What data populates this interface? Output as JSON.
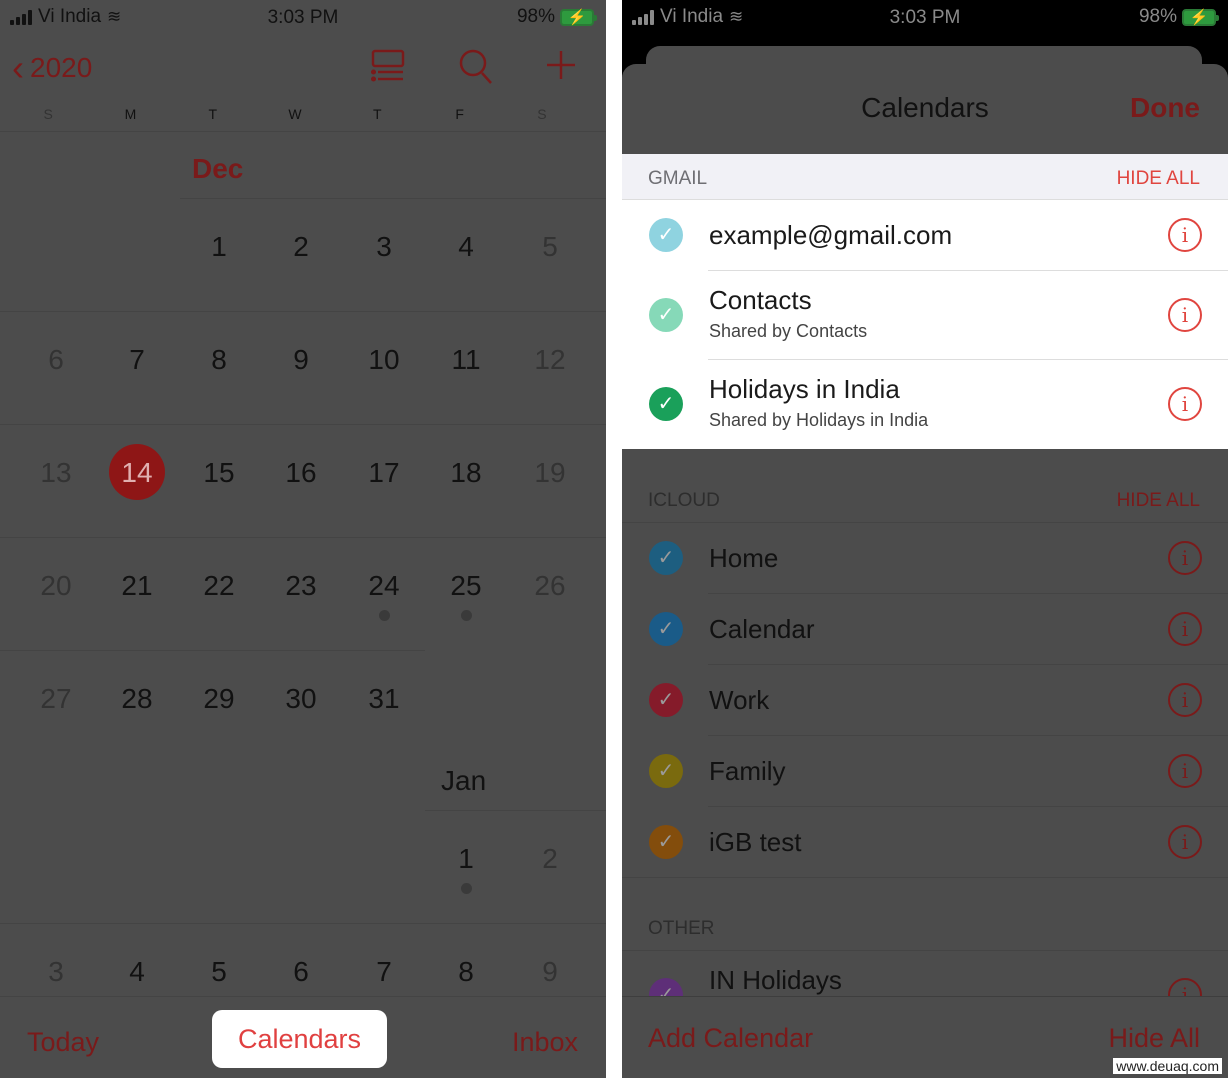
{
  "status_bar": {
    "carrier": "Vi India",
    "time": "3:03 PM",
    "battery": "98%"
  },
  "left": {
    "nav": {
      "back_label": "2020",
      "icons": [
        "list-view-icon",
        "search-icon",
        "add-icon"
      ]
    },
    "weekdays": [
      "S",
      "M",
      "T",
      "W",
      "T",
      "F",
      "S"
    ],
    "months": {
      "dec": "Dec",
      "jan": "Jan"
    },
    "weeks": [
      [
        "",
        "",
        "1",
        "2",
        "3",
        "4",
        "5"
      ],
      [
        "6",
        "7",
        "8",
        "9",
        "10",
        "11",
        "12"
      ],
      [
        "13",
        "14",
        "15",
        "16",
        "17",
        "18",
        "19"
      ],
      [
        "20",
        "21",
        "22",
        "23",
        "24",
        "25",
        "26"
      ],
      [
        "27",
        "28",
        "29",
        "30",
        "31",
        "",
        ""
      ],
      [
        "",
        "",
        "",
        "",
        "",
        "1",
        "2"
      ],
      [
        "3",
        "4",
        "5",
        "6",
        "7",
        "8",
        "9"
      ]
    ],
    "today": "14",
    "event_dots": [
      "Dec 24",
      "Dec 25",
      "Jan 1"
    ],
    "toolbar": {
      "today": "Today",
      "calendars": "Calendars",
      "inbox": "Inbox"
    }
  },
  "right": {
    "title": "Calendars",
    "done": "Done",
    "sections": {
      "gmail": {
        "label": "GMAIL",
        "hide_all": "HIDE ALL",
        "items": [
          {
            "name": "example@gmail.com",
            "sub": "",
            "color": "#8fd3e0",
            "checked": true
          },
          {
            "name": "Contacts",
            "sub": "Shared by Contacts",
            "color": "#86d9b8",
            "checked": true
          },
          {
            "name": "Holidays in India",
            "sub": "Shared by Holidays in India",
            "color": "#1aa05a",
            "checked": true
          }
        ]
      },
      "icloud": {
        "label": "ICLOUD",
        "hide_all": "HIDE ALL",
        "items": [
          {
            "name": "Home",
            "color": "#1d5e80",
            "checked": true
          },
          {
            "name": "Calendar",
            "color": "#1a5b88",
            "checked": true
          },
          {
            "name": "Work",
            "color": "#851b2a",
            "checked": true
          },
          {
            "name": "Family",
            "color": "#7a6a0e",
            "checked": true
          },
          {
            "name": "iGB test",
            "color": "#834d0c",
            "checked": true
          }
        ]
      },
      "other": {
        "label": "OTHER",
        "items": [
          {
            "name": "IN Holidays",
            "color": "#5e2f78",
            "checked": true
          }
        ]
      }
    },
    "toolbar": {
      "add_calendar": "Add Calendar",
      "hide_all": "Hide All"
    }
  },
  "watermark": "www.deuaq.com"
}
